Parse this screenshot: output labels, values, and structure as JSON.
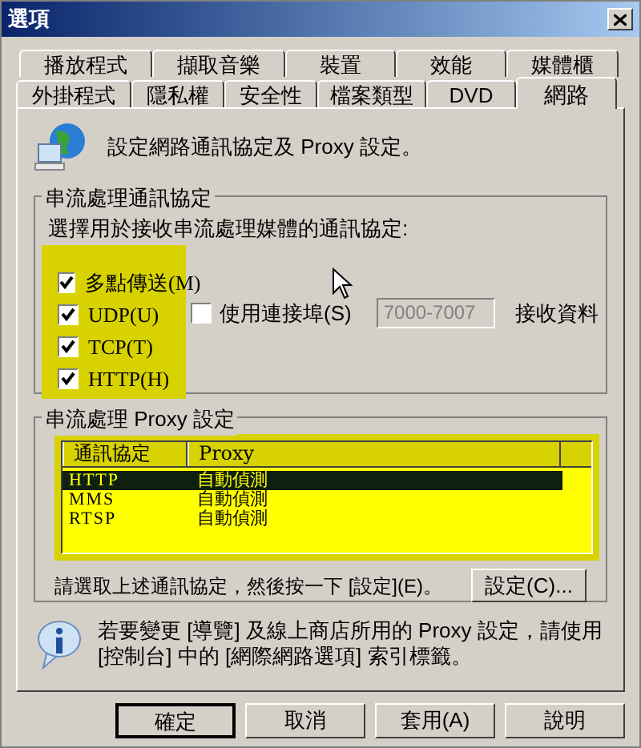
{
  "window": {
    "title": "選項"
  },
  "tab_rows": [
    [
      {
        "label": "播放程式",
        "selected": false
      },
      {
        "label": "擷取音樂",
        "selected": false
      },
      {
        "label": "裝置",
        "selected": false
      },
      {
        "label": "效能",
        "selected": false
      },
      {
        "label": "媒體櫃",
        "selected": false
      }
    ],
    [
      {
        "label": "外掛程式",
        "selected": false
      },
      {
        "label": "隱私權",
        "selected": false
      },
      {
        "label": "安全性",
        "selected": false
      },
      {
        "label": "檔案類型",
        "selected": false
      },
      {
        "label": "DVD",
        "selected": false
      },
      {
        "label": "網路",
        "selected": true
      }
    ]
  ],
  "description": "設定網路通訊協定及 Proxy 設定。",
  "protocol_group": {
    "title": "串流處理通訊協定",
    "prompt": "選擇用於接收串流處理媒體的通訊協定:",
    "protocols": [
      {
        "label": "多點傳送(M)",
        "checked": true
      },
      {
        "label": "UDP(U)",
        "checked": true
      },
      {
        "label": "TCP(T)",
        "checked": true
      },
      {
        "label": "HTTP(H)",
        "checked": true
      }
    ],
    "port": {
      "label": "使用連接埠(S)",
      "checked": false,
      "value": "7000-7007",
      "disabled": true,
      "suffix": "接收資料"
    }
  },
  "proxy_group": {
    "title": "串流處理 Proxy 設定",
    "columns": [
      "通訊協定",
      "Proxy"
    ],
    "rows": [
      {
        "protocol": "HTTP",
        "proxy": "自動偵測",
        "selected": true
      },
      {
        "protocol": "MMS",
        "proxy": "自動偵測",
        "selected": false
      },
      {
        "protocol": "RTSP",
        "proxy": "自動偵測",
        "selected": false
      }
    ],
    "hint": "請選取上述通訊協定，然後按一下 [設定](E)。",
    "settings_button": "設定(C)..."
  },
  "info": "若要變更 [導覽] 及線上商店所用的 Proxy 設定，請使用 [控制台] 中的 [網際網路選項] 索引標籤。",
  "buttons": [
    {
      "label": "確定",
      "default": true
    },
    {
      "label": "取消",
      "default": false
    },
    {
      "label": "套用(A)",
      "default": false
    },
    {
      "label": "說明",
      "default": false
    }
  ]
}
